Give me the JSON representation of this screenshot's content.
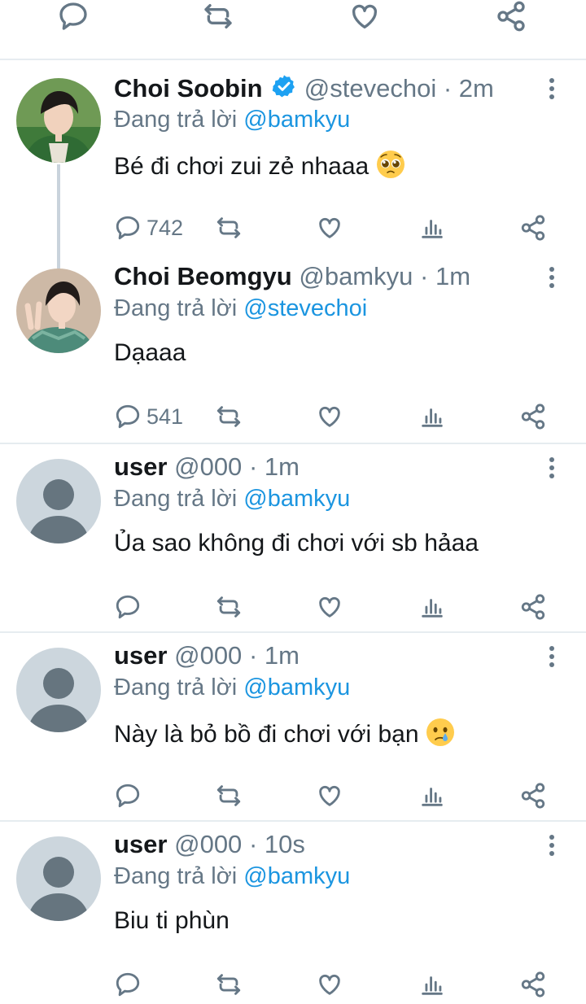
{
  "reply_prefix": "Đang trả lời",
  "colors": {
    "text": "#14171a",
    "secondary": "#657786",
    "link": "#1b95e0",
    "separator": "#e6ecf0"
  },
  "tweets": [
    {
      "name": "Choi Soobin",
      "verified": true,
      "handle": "@stevechoi",
      "dot": "·",
      "time": "2m",
      "reply_to": "@bamkyu",
      "text": "Bé đi chơi zui zẻ nhaaa",
      "emoji": "pleading-face",
      "reply_count": "742"
    },
    {
      "name": "Choi Beomgyu",
      "handle": "@bamkyu",
      "dot": "·",
      "time": "1m",
      "reply_to": "@stevechoi",
      "text": "Dạaaa",
      "reply_count": "541"
    },
    {
      "name": "user",
      "handle": "@000",
      "dot": "·",
      "time": "1m",
      "reply_to": "@bamkyu",
      "text": "Ủa sao không đi chơi với sb hảaa"
    },
    {
      "name": "user",
      "handle": "@000",
      "dot": "·",
      "time": "1m",
      "reply_to": "@bamkyu",
      "text": "Này là bỏ bồ đi chơi với bạn",
      "emoji": "crying-face"
    },
    {
      "name": "user",
      "handle": "@000",
      "dot": "·",
      "time": "10s",
      "reply_to": "@bamkyu",
      "text": "Biu ti phùn"
    }
  ]
}
